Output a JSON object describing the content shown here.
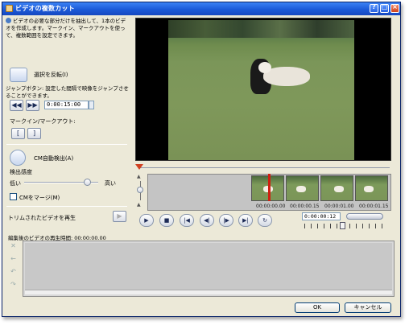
{
  "window": {
    "title": "ビデオの複数カット"
  },
  "help_text": "ビデオの必要な部分だけを抽出して、1本のビデオを作成します。マークイン、マークアウトを使って、複数範囲を設定できます。",
  "invert": {
    "label": "選択を反転(I)"
  },
  "jump": {
    "description": "ジャンプボタン: 設定した間隔で映像をジャンプさせることができます。",
    "interval_value": "0:00:15:00"
  },
  "mark": {
    "label": "マークイン/マークアウト:",
    "in_symbol": "[",
    "out_symbol": "]"
  },
  "cm_detect": {
    "label": "CM自動検出(A)",
    "sensitivity_label": "検出感度",
    "low_label": "低い",
    "high_label": "高い",
    "sensitivity_level": 0.85,
    "merge_label": "CMをマージ(M)"
  },
  "trim_play_label": "トリムされたビデオを再生",
  "timeline": {
    "time_labels": [
      "00:00:00.00",
      "00:00:00.15",
      "00:00:01.00",
      "00:00:01.15"
    ],
    "current_timecode": "0:00:00:12"
  },
  "edited_duration": {
    "label": "編集後のビデオの再生時間:",
    "value": "00:00:00.00"
  },
  "buttons": {
    "ok": "OK",
    "cancel": "キャンセル"
  },
  "playback_icons": [
    "play-icon",
    "stop-icon",
    "go-start-icon",
    "prev-frame-icon",
    "next-frame-icon",
    "go-end-icon",
    "repeat-icon"
  ]
}
